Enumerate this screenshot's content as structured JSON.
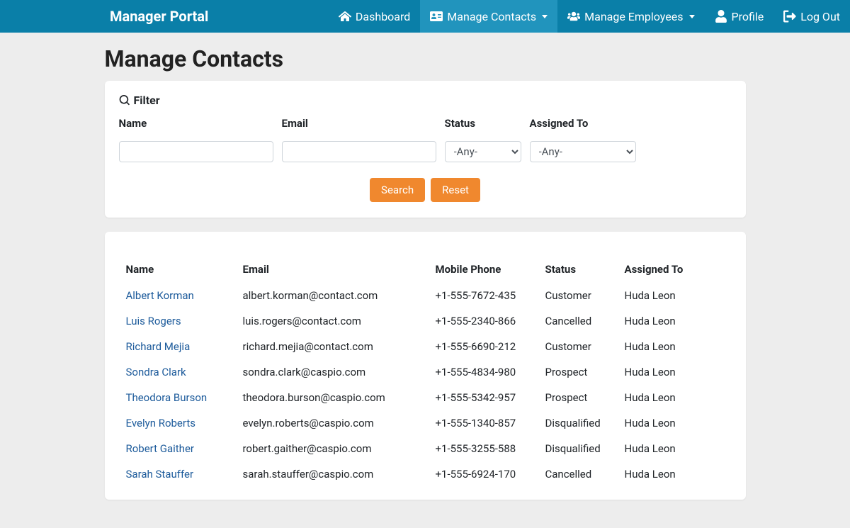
{
  "brand": "Manager Portal",
  "nav": {
    "dashboard": "Dashboard",
    "manage_contacts": "Manage Contacts",
    "manage_employees": "Manage Employees",
    "profile": "Profile",
    "logout": "Log Out"
  },
  "page_title": "Manage Contacts",
  "filter": {
    "heading": "Filter",
    "labels": {
      "name": "Name",
      "email": "Email",
      "status": "Status",
      "assigned": "Assigned To"
    },
    "status_any": "-Any-",
    "assigned_any": "-Any-",
    "search_btn": "Search",
    "reset_btn": "Reset"
  },
  "table": {
    "headers": {
      "name": "Name",
      "email": "Email",
      "phone": "Mobile Phone",
      "status": "Status",
      "assigned": "Assigned To"
    },
    "rows": [
      {
        "name": "Albert Korman",
        "email": "albert.korman@contact.com",
        "phone": "+1-555-7672-435",
        "status": "Customer",
        "assigned": "Huda Leon"
      },
      {
        "name": "Luis Rogers",
        "email": "luis.rogers@contact.com",
        "phone": "+1-555-2340-866",
        "status": "Cancelled",
        "assigned": "Huda Leon"
      },
      {
        "name": "Richard Mejia",
        "email": "richard.mejia@contact.com",
        "phone": "+1-555-6690-212",
        "status": "Customer",
        "assigned": "Huda Leon"
      },
      {
        "name": "Sondra Clark",
        "email": "sondra.clark@caspio.com",
        "phone": "+1-555-4834-980",
        "status": "Prospect",
        "assigned": "Huda Leon"
      },
      {
        "name": "Theodora Burson",
        "email": "theodora.burson@caspio.com",
        "phone": "+1-555-5342-957",
        "status": "Prospect",
        "assigned": "Huda Leon"
      },
      {
        "name": "Evelyn Roberts",
        "email": "evelyn.roberts@caspio.com",
        "phone": "+1-555-1340-857",
        "status": "Disqualified",
        "assigned": "Huda Leon"
      },
      {
        "name": "Robert Gaither",
        "email": "robert.gaither@caspio.com",
        "phone": "+1-555-3255-588",
        "status": "Disqualified",
        "assigned": "Huda Leon"
      },
      {
        "name": "Sarah Stauffer",
        "email": "sarah.stauffer@caspio.com",
        "phone": "+1-555-6924-170",
        "status": "Cancelled",
        "assigned": "Huda Leon"
      }
    ]
  }
}
